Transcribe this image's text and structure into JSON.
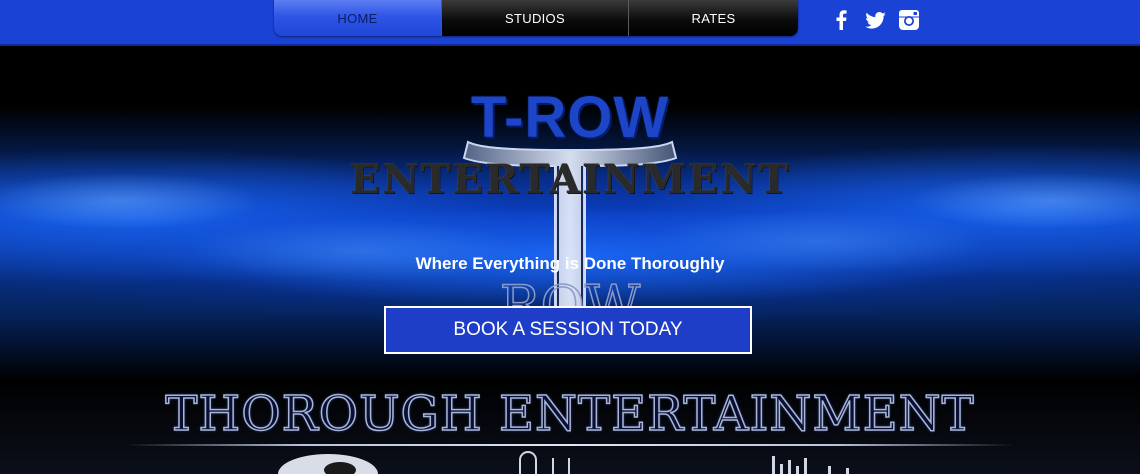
{
  "nav": {
    "items": [
      {
        "label": "HOME",
        "active": true
      },
      {
        "label": "STUDIOS",
        "active": false
      },
      {
        "label": "RATES",
        "active": false
      }
    ]
  },
  "social": {
    "icons": [
      "facebook-icon",
      "twitter-icon",
      "instagram-icon"
    ]
  },
  "hero": {
    "brand_title": "T-ROW",
    "brand_subtitle": "ENTERTAINMENT",
    "logo_text": "ROW",
    "tagline": "Where Everything is Done Thoroughly",
    "cta_label": "BOOK A SESSION TODAY",
    "footer_title": "THOROUGH ENTERTAINMENT"
  },
  "colors": {
    "topbar": "#1a43d6",
    "nav_active": "#2e55e6",
    "cta_bg": "#1f3ec8",
    "brand_blue": "#1d45c8"
  }
}
